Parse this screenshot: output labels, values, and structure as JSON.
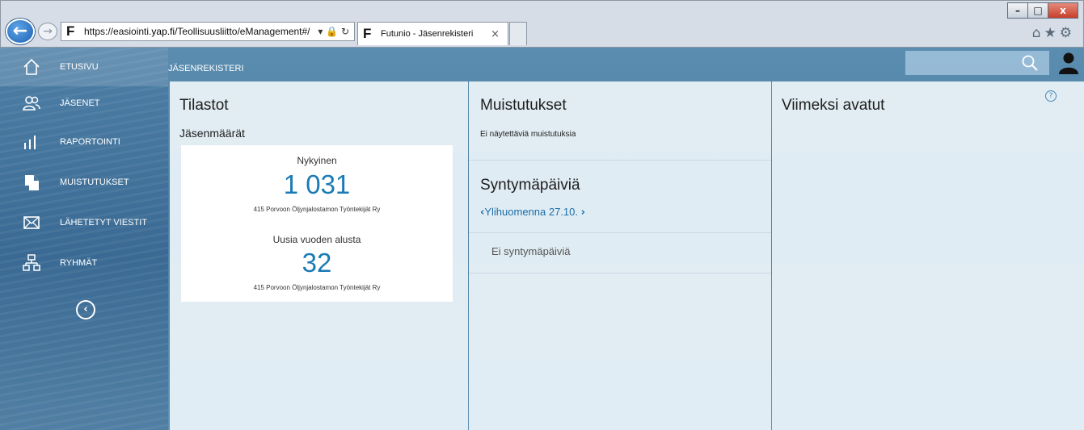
{
  "browser": {
    "url_prefix": "https://easiointi.",
    "url_domain": "yap.fi",
    "url_path": "/Teollisuusliitto/eManagement#/",
    "address_icons": "▾ 🔒 ↻",
    "tab_title": "Futunio - Jäsenrekisteri",
    "tab_close": "×",
    "favicon": "F",
    "window_buttons": [
      "–",
      "□",
      "x"
    ],
    "toolbar_icons": "⌂★⚙"
  },
  "sidebar": {
    "items": [
      {
        "label": "ETUSIVU",
        "icon": "home-icon"
      },
      {
        "label": "JÄSENET",
        "icon": "members-icon"
      },
      {
        "label": "RAPORTOINTI",
        "icon": "reports-icon"
      },
      {
        "label": "MUISTUTUKSET",
        "icon": "reminders-icon"
      },
      {
        "label": "LÄHETETYT VIESTIT",
        "icon": "mail-icon"
      },
      {
        "label": "RYHMÄT",
        "icon": "groups-icon"
      }
    ],
    "collapse_glyph": "‹"
  },
  "header": {
    "title": "JÄSENREKISTERI"
  },
  "stats": {
    "title": "Tilastot",
    "subtitle": "Jäsenmäärät",
    "current_label": "Nykyinen",
    "current_value": "1 031",
    "current_org": "415 Porvoon Öljynjalostamon Työntekijät Ry",
    "new_label": "Uusia vuoden alusta",
    "new_value": "32",
    "new_org": "415 Porvoon Öljynjalostamon Työntekijät Ry"
  },
  "reminders": {
    "title": "Muistutukset",
    "empty": "Ei näytettäviä muistutuksia"
  },
  "birthdays": {
    "title": "Syntymäpäiviä",
    "date_label": "Ylihuomenna 27.10.",
    "empty": "Ei syntymäpäiviä"
  },
  "recent": {
    "title": "Viimeksi avatut"
  },
  "help_glyph": "?",
  "colors": {
    "accent": "#1a7ab5",
    "sidebar": "#3a6a93"
  }
}
